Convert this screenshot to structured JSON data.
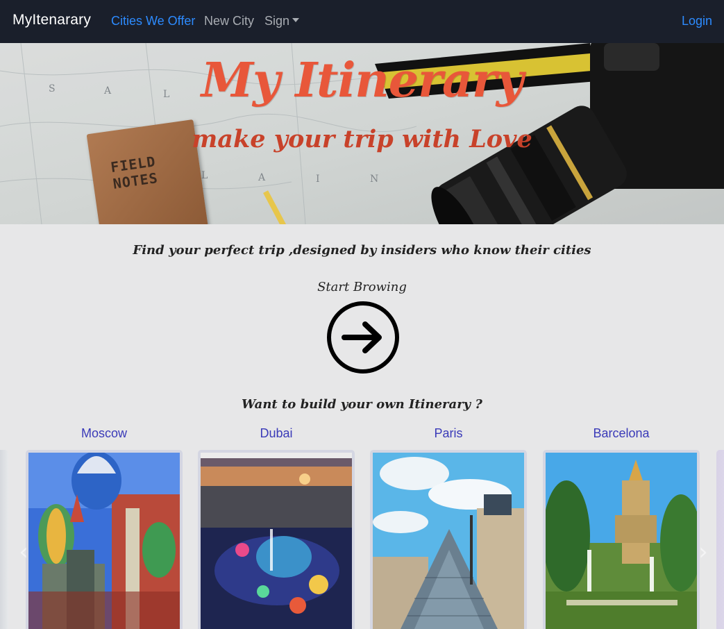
{
  "nav": {
    "brand": "MyItenarary",
    "links": [
      {
        "label": "Cities We Offer",
        "active": true
      },
      {
        "label": "New City",
        "active": false
      },
      {
        "label": "Sign",
        "active": false
      }
    ],
    "login": "Login"
  },
  "hero": {
    "title": "My Itinerary",
    "subtitle": "make your trip with Love",
    "notebook_text": "FIELD NOTES"
  },
  "main": {
    "tagline": "Find your perfect trip ,designed by insiders who know their cities",
    "start_label": "Start Browing",
    "build_label": "Want to build your own Itinerary ?"
  },
  "cities": [
    {
      "name": "Moscow"
    },
    {
      "name": "Dubai"
    },
    {
      "name": "Paris"
    },
    {
      "name": "Barcelona"
    }
  ],
  "colors": {
    "nav_bg": "#1a1f2b",
    "accent": "#2d8bff",
    "hero_title": "#e8573a",
    "city_link": "#3a3ab8",
    "page_bg": "#e7e7e8"
  }
}
